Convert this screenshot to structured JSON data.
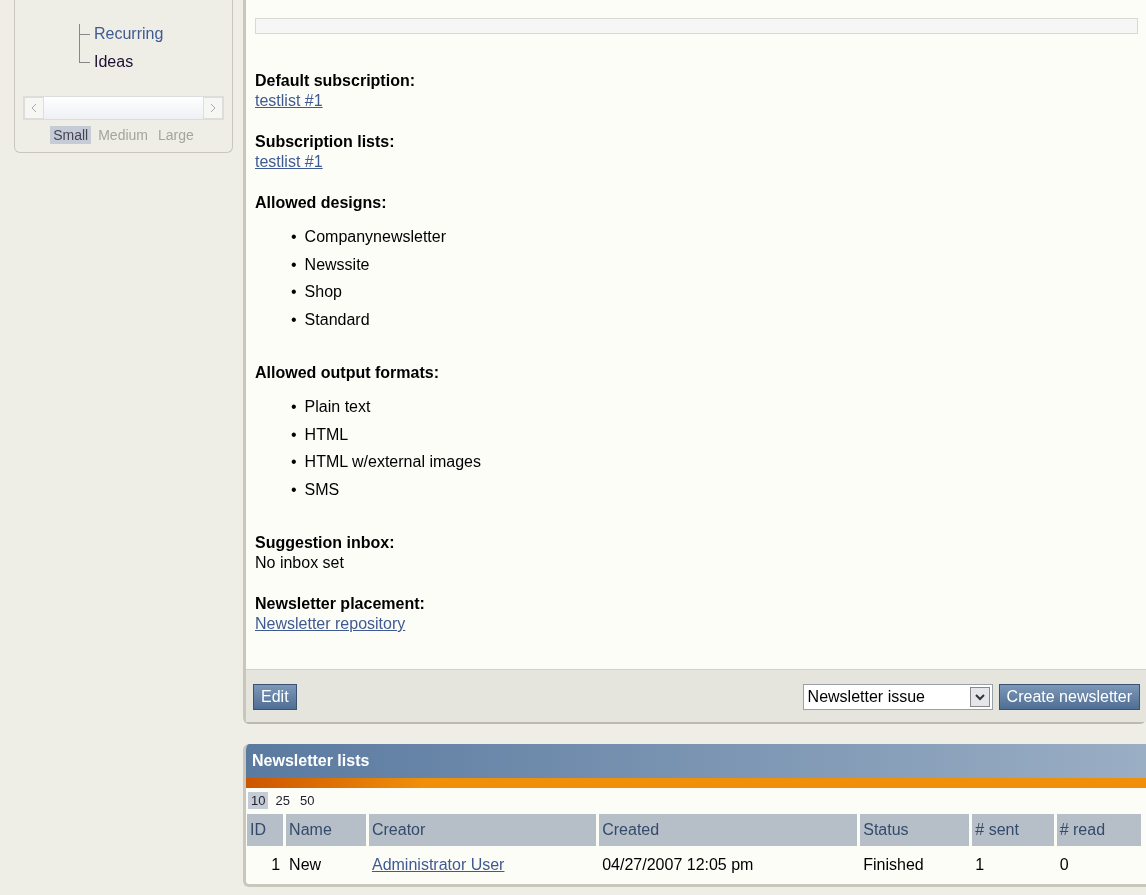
{
  "sidebar": {
    "tree_items": [
      {
        "label": "Recurring",
        "selected": false
      },
      {
        "label": "Ideas",
        "selected": true
      }
    ],
    "text_sizes": [
      {
        "label": "Small",
        "selected": true
      },
      {
        "label": "Medium",
        "selected": false
      },
      {
        "label": "Large",
        "selected": false
      }
    ]
  },
  "details": {
    "sections": [
      {
        "heading": "Default subscription:",
        "kind": "link",
        "value": "testlist #1"
      },
      {
        "heading": "Subscription lists:",
        "kind": "link",
        "value": "testlist #1"
      },
      {
        "heading": "Allowed designs:",
        "kind": "list",
        "marker": "•",
        "items": [
          "Companynewsletter",
          "Newssite",
          "Shop",
          "Standard"
        ]
      },
      {
        "heading": "Allowed output formats:",
        "kind": "list",
        "marker": "•",
        "items": [
          "Plain text",
          "HTML",
          "HTML w/external images",
          "SMS"
        ]
      },
      {
        "heading": "Suggestion inbox:",
        "kind": "text",
        "value": "No inbox set"
      },
      {
        "heading": "Newsletter placement:",
        "kind": "link",
        "value": "Newsletter repository"
      }
    ],
    "edit_button": "Edit",
    "type_select": {
      "value": "Newsletter issue"
    },
    "create_button": "Create newsletter"
  },
  "newsletter_lists": {
    "title": "Newsletter lists",
    "page_sizes": [
      {
        "label": "10",
        "selected": true
      },
      {
        "label": "25",
        "selected": false
      },
      {
        "label": "50",
        "selected": false
      }
    ],
    "columns": [
      "ID",
      "Name",
      "Creator",
      "Created",
      "Status",
      "# sent",
      "# read"
    ],
    "rows": [
      {
        "id": "1",
        "name": "New",
        "creator": "Administrator User",
        "created": "04/27/2007 12:05 pm",
        "status": "Finished",
        "sent": "1",
        "read": "0"
      }
    ]
  }
}
